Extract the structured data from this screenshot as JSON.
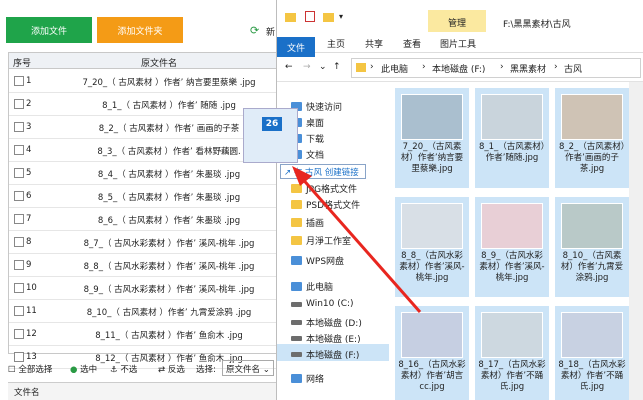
{
  "app": {
    "add_file": "添加文件",
    "add_folder": "添加文件夹",
    "refresh_label": "新",
    "col_no": "序号",
    "col_name": "原文件名",
    "rows": [
      {
        "no": "1",
        "name": "7_20_（ 古风素材 ）作者’ 纳言要里蔡樂 .jpg"
      },
      {
        "no": "2",
        "name": "8_1_（ 古风素材 ）作者’ 随随 .jpg"
      },
      {
        "no": "3",
        "name": "8_2_（ 古风素材 ）作者’ 画画的子茶"
      },
      {
        "no": "4",
        "name": "8_3_（ 古风素材 ）作者’ 看林野藕圆."
      },
      {
        "no": "5",
        "name": "8_4_（ 古风素材 ）作者’ 朱墨琰 .jpg"
      },
      {
        "no": "6",
        "name": "8_5_（ 古风素材 ）作者’ 朱墨琰 .jpg"
      },
      {
        "no": "7",
        "name": "8_6_（ 古风素材 ）作者’ 朱墨琰 .jpg"
      },
      {
        "no": "8",
        "name": "8_7_（ 古风水彩素材 ）作者’ 溪风-桃年 .jpg"
      },
      {
        "no": "9",
        "name": "8_8_（ 古风水彩素材 ）作者’ 溪风-桃年 .jpg"
      },
      {
        "no": "10",
        "name": "8_9_（ 古风水彩素材 ）作者’ 溪风-桃年 .jpg"
      },
      {
        "no": "11",
        "name": "8_10_（ 古风素材 ）作者’ 九霄爱涂鸦 .jpg"
      },
      {
        "no": "12",
        "name": "8_11_（ 古风素材 ）作者’ 鱼俞木 .jpg"
      },
      {
        "no": "13",
        "name": "8_12_（ 古风素材 ）作者’ 鱼俞木 .jpg"
      }
    ],
    "select_all": "全部选择",
    "select_mid": "选中",
    "not_select": "不选",
    "invert": "反选",
    "select_label": "选择:",
    "select_value": "原文件名",
    "bottom_col": "文件名"
  },
  "explorer": {
    "manage_tab": "管理",
    "path_title": "F:\\黑黑素材\\古风",
    "ribbon": [
      "文件",
      "主页",
      "共享",
      "查看",
      "图片工具"
    ],
    "breadcrumb": [
      "此电脑",
      "本地磁盘 (F:)",
      "黑黑素材",
      "古风"
    ],
    "nav": [
      {
        "label": "快速访问",
        "icon": "star-icon"
      },
      {
        "label": "桌面",
        "icon": "desktop-icon"
      },
      {
        "label": "下载",
        "icon": "download-icon"
      },
      {
        "label": "文档",
        "icon": "document-icon"
      },
      {
        "label": "JPG格式文件",
        "icon": "folder-icon"
      },
      {
        "label": "PSD格式文件",
        "icon": "folder-icon"
      },
      {
        "label": "插画",
        "icon": "folder-icon"
      },
      {
        "label": "月淨工作室",
        "icon": "folder-icon"
      },
      {
        "label": "WPS网盘",
        "icon": "cloud-icon"
      },
      {
        "label": "此电脑",
        "icon": "computer-icon"
      },
      {
        "label": "Win10 (C:)",
        "icon": "drive-icon"
      },
      {
        "label": "本地磁盘 (D:)",
        "icon": "drive-icon"
      },
      {
        "label": "本地磁盘 (E:)",
        "icon": "drive-icon"
      },
      {
        "label": "本地磁盘 (F:)",
        "icon": "drive-icon"
      },
      {
        "label": "网络",
        "icon": "network-icon"
      }
    ],
    "thumbs": [
      {
        "caption": "7_20_（古风素材）作者’纳言要里蔡樂.jpg",
        "color": "#aabfcf"
      },
      {
        "caption": "8_1_（古风素材）作者’随随.jpg",
        "color": "#c9d4dc"
      },
      {
        "caption": "8_2_（古风素材）作者’画画的子茶.jpg",
        "color": "#cfc3b5"
      },
      {
        "caption": "8_8_（古风水彩素材）作者’溪风-桃年.jpg",
        "color": "#d8dfe6"
      },
      {
        "caption": "8_9_（古风水彩素材）作者’溪风-桃年.jpg",
        "color": "#e8cfd6"
      },
      {
        "caption": "8_10_（古风素材）作者’九霄爱涂鸦.jpg",
        "color": "#b9c9c8"
      },
      {
        "caption": "8_16_（古风水彩素材）作者’胡言cc.jpg",
        "color": "#c6cfe2"
      },
      {
        "caption": "8_17_（古风水彩素材）作者’不踊氏.jpg",
        "color": "#cdd8e0"
      },
      {
        "caption": "8_18_（古风水彩素材）作者’不踊氏.jpg",
        "color": "#c8d1e2"
      }
    ]
  },
  "drag": {
    "count": "26",
    "link_text": "在 古风 创建链接"
  }
}
